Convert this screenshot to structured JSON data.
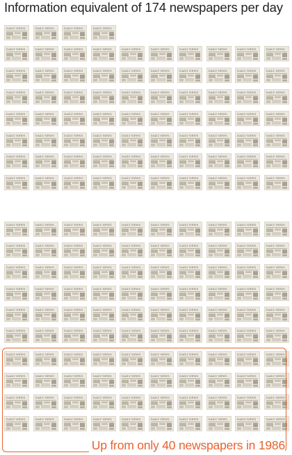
{
  "header": {
    "title": "Information equivalent of 174 newspapers per day"
  },
  "newspaper": {
    "masthead": "DAILY NEWS",
    "icon": "newspaper-icon"
  },
  "grid": {
    "total_newspapers": 174,
    "highlighted_newspapers": 40
  },
  "footer": {
    "caption": "Up from only 40 newspapers in 1986"
  },
  "colors": {
    "accent": "#e8622f",
    "paper": "#ece8df",
    "text": "#222222"
  }
}
